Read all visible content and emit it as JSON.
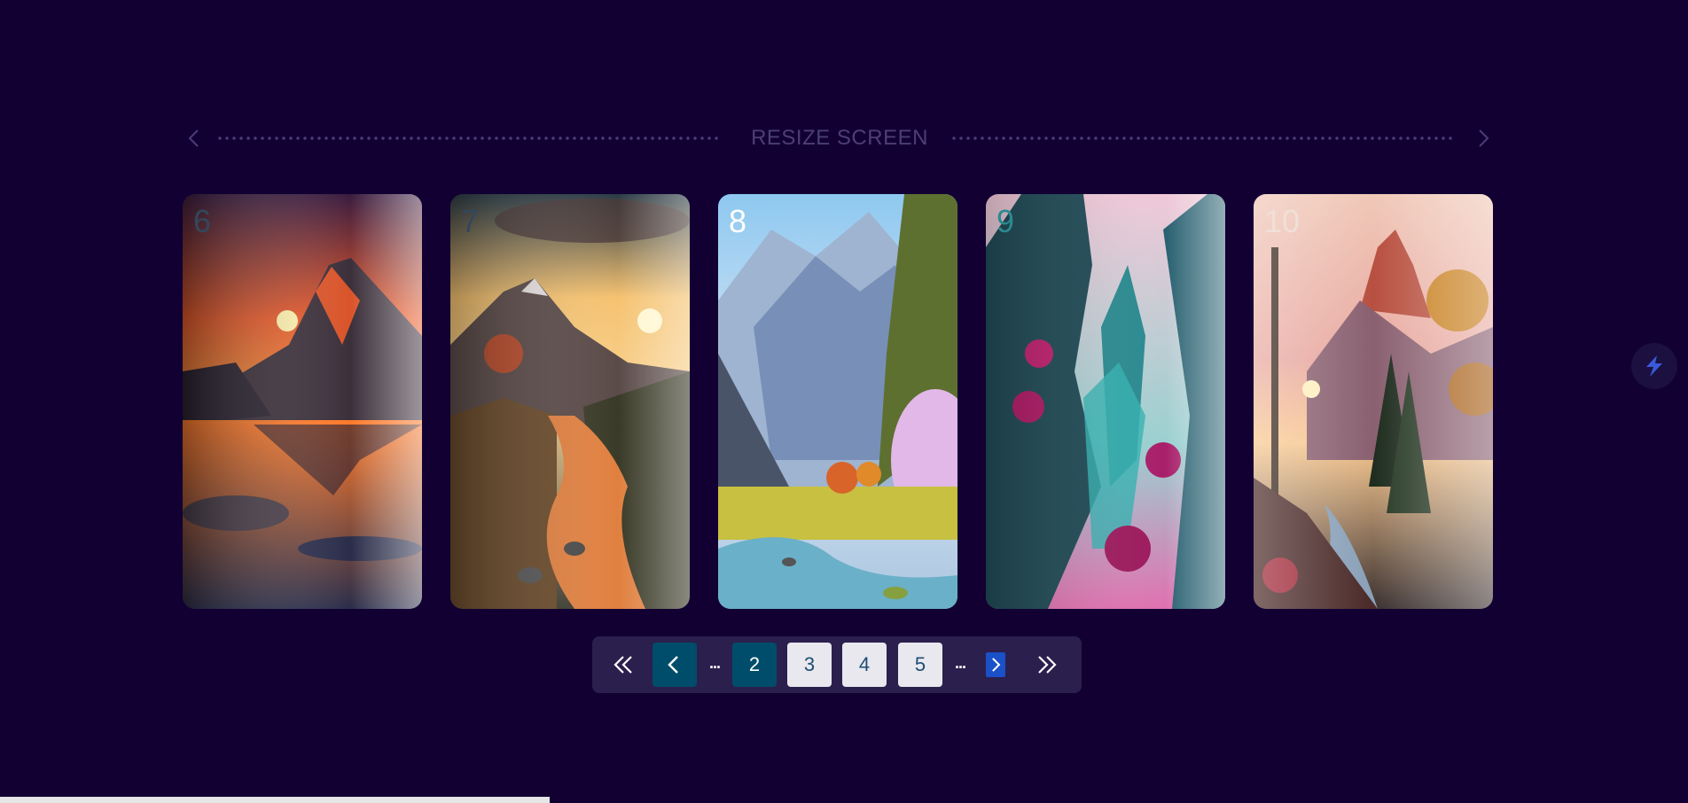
{
  "header": {
    "title": "RESIZE SCREEN",
    "prev_icon": "chevron-left-icon",
    "next_icon": "chevron-right-icon"
  },
  "cards": [
    {
      "number": "6",
      "scene": "sunset-mountain-lake"
    },
    {
      "number": "7",
      "scene": "mountain-river-sunrise"
    },
    {
      "number": "8",
      "scene": "snowy-peaks-valley"
    },
    {
      "number": "9",
      "scene": "teal-canyon-pink-trees"
    },
    {
      "number": "10",
      "scene": "autumn-forest-river"
    }
  ],
  "pagination": {
    "first_icon": "double-chevron-left-icon",
    "prev_icon": "chevron-left-icon",
    "ellipsis": "...",
    "pages": [
      "2",
      "3",
      "4",
      "5"
    ],
    "current_page": "2",
    "next_icon": "chevron-right-icon",
    "last_icon": "double-chevron-right-icon"
  },
  "colors": {
    "background": "#120033",
    "pager_background": "#2b1f4d",
    "active_page": "#004d6b",
    "inactive_page": "#e8e8ee",
    "header_text": "#4b3f74"
  },
  "side_widget": {
    "icon": "lightning-logo-icon"
  }
}
